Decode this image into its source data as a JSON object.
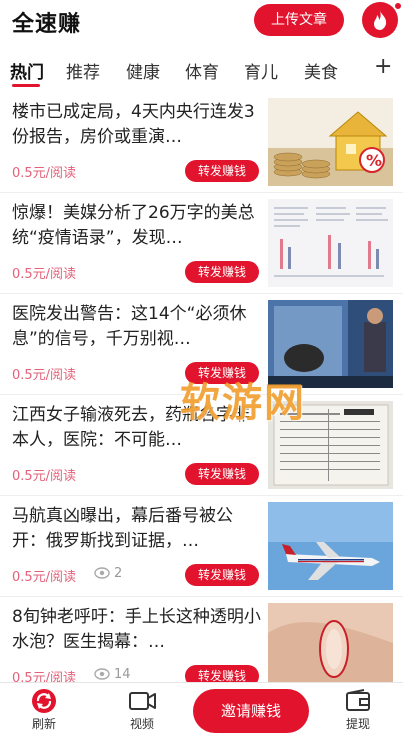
{
  "header": {
    "app_title": "全速赚",
    "upload_label": "上传文章"
  },
  "tabs": [
    {
      "label": "热门",
      "active": true
    },
    {
      "label": "推荐"
    },
    {
      "label": "健康"
    },
    {
      "label": "体育"
    },
    {
      "label": "育儿"
    },
    {
      "label": "美食"
    }
  ],
  "tabs_plus": "+",
  "articles": [
    {
      "title": "楼市已成定局，4天内央行连发3份报告，房价或重演…",
      "price": "0.5元/阅读",
      "views": "",
      "share": "转发赚钱"
    },
    {
      "title": "惊爆！美媒分析了26万字的美总统“疫情语录”，发现…",
      "price": "0.5元/阅读",
      "views": "",
      "share": "转发赚钱"
    },
    {
      "title": "医院发出警告：这14个“必须休息”的信号，千万别视…",
      "price": "0.5元/阅读",
      "views": "",
      "share": "转发赚钱"
    },
    {
      "title": "江西女子输液死去，药瓶名字非本人，医院：不可能…",
      "price": "0.5元/阅读",
      "views": "",
      "share": "转发赚钱"
    },
    {
      "title": "马航真凶曝出，幕后番号被公开：俄罗斯找到证据，…",
      "price": "0.5元/阅读",
      "views": "2",
      "share": "转发赚钱"
    },
    {
      "title": "8旬钟老呼吁：手上长这种透明小水泡？医生揭幕：…",
      "price": "0.5元/阅读",
      "views": "14",
      "share": "转发赚钱"
    }
  ],
  "watermark": "软游网",
  "bottom_nav": {
    "refresh": "刷新",
    "video": "视频",
    "invite": "邀请赚钱",
    "withdraw": "提现"
  },
  "colors": {
    "accent": "#e2142d",
    "price": "#e2627a"
  }
}
